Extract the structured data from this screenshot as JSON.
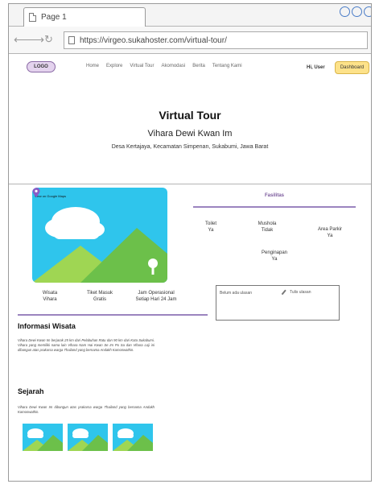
{
  "browser": {
    "tab_title": "Page 1",
    "url": "https://virgeo.sukahoster.com/virtual-tour/"
  },
  "header": {
    "logo": "LOGO",
    "nav": [
      "Home",
      "Explore",
      "Virtual Tour",
      "Akomodasi",
      "Berita",
      "Tentang Kami"
    ],
    "user": "Hi, User",
    "dashboard": "Dashboard"
  },
  "hero": {
    "title": "Virtual Tour",
    "subtitle": "Vihara Dewi Kwan Im",
    "address": "Desa Kertajaya, Kecamatan Simpenan, Sukabumi, Jawa Barat"
  },
  "image_card": {
    "map_link": "View on Google Maps"
  },
  "info": [
    {
      "label": "Wisata",
      "value": "Vihara"
    },
    {
      "label": "Tiket Masuk",
      "value": "Gratis"
    },
    {
      "label": "Jam Operasional",
      "value": "Setiap Hari 24 Jam"
    }
  ],
  "fasilitas": {
    "title": "Fasilitas",
    "items": [
      {
        "name": "Toilet",
        "value": "Ya"
      },
      {
        "name": "Mushola",
        "value": "Tidak"
      },
      {
        "name": "Area Parkir",
        "value": "Ya"
      },
      {
        "name": "Penginapan",
        "value": "Ya"
      }
    ]
  },
  "ulasan": {
    "empty_text": "Belum ada ulasan",
    "write_label": "Tulis ulasan"
  },
  "informasi": {
    "title": "Informasi Wisata",
    "text": "Vihara Dewi Kwan Im berjarak 25 km dari Pelabuhan Ratu dan 90 km dari Kota Sukabumi. Vihara yang memiliki nama lain Vihara Nam Hai Kwan Se Im Po Sa dan Vihara Loji ini dibangun atas prakarsa warga Thailand yang bernama Andakh Kamonwathin."
  },
  "sejarah": {
    "title": "Sejarah",
    "text": "Vihara Dewi Kwan Im dibangun atas prakarsa warga Thailand yang bernama Andakh Kamonwathin."
  }
}
